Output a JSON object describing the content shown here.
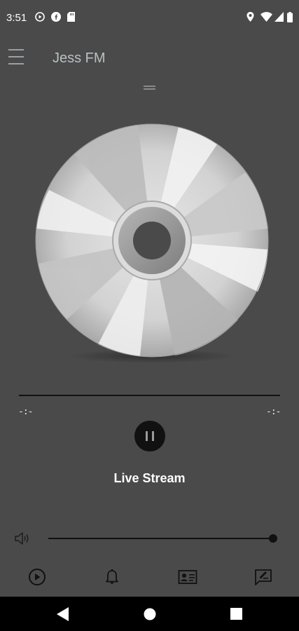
{
  "status_bar": {
    "time": "3:51",
    "left_icons": [
      "media-play-circle-icon",
      "facebook-icon",
      "sd-card-icon"
    ],
    "right_icons": [
      "location-icon",
      "wifi-icon",
      "signal-icon",
      "battery-icon"
    ]
  },
  "app_bar": {
    "title": "Jess FM",
    "menu_icon": "hamburger-menu-icon"
  },
  "player": {
    "artwork": "cd-disc-image",
    "elapsed": "-:-",
    "duration": "-:-",
    "state": "playing",
    "control_icon": "pause-icon",
    "stream_title": "Live Stream",
    "progress": 0
  },
  "volume": {
    "icon": "speaker-icon",
    "level": 1.0
  },
  "bottom_tabs": [
    {
      "icon": "play-circle-icon"
    },
    {
      "icon": "bell-icon"
    },
    {
      "icon": "contact-card-icon"
    },
    {
      "icon": "feedback-icon"
    }
  ],
  "nav_bar": [
    "back-icon",
    "home-icon",
    "recents-icon"
  ],
  "colors": {
    "background": "#4a4a4a",
    "control_dark": "#111111",
    "title_text": "#b8c0c2"
  }
}
